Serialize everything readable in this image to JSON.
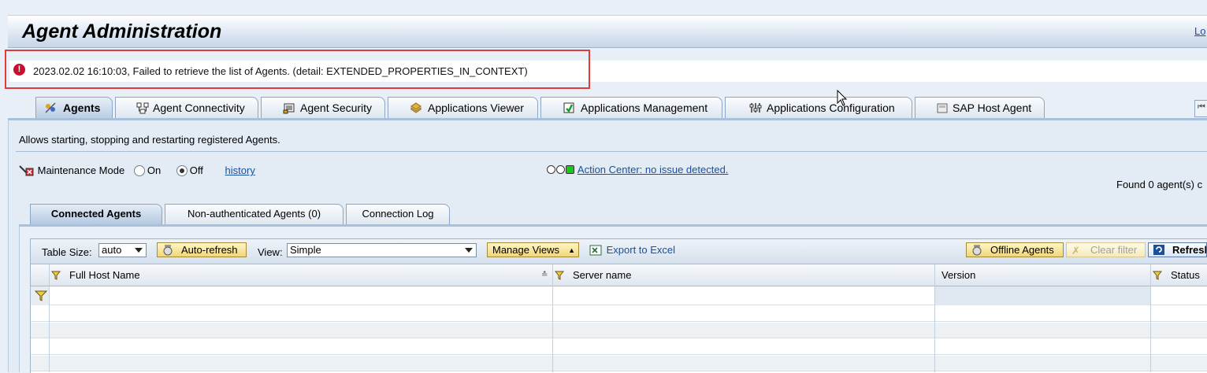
{
  "header": {
    "title": "Agent Administration",
    "logout_label": "Lo"
  },
  "message": {
    "text": "2023.02.02 16:10:03, Failed to retrieve the list of Agents. (detail: EXTENDED_PROPERTIES_IN_CONTEXT)",
    "icon": "error-icon",
    "highlight_color": "#e33b3b"
  },
  "tabs": [
    {
      "label": "Agents",
      "icon": "agents-icon",
      "active": true
    },
    {
      "label": "Agent Connectivity",
      "icon": "connectivity-icon"
    },
    {
      "label": "Agent Security",
      "icon": "security-icon"
    },
    {
      "label": "Applications Viewer",
      "icon": "viewer-icon"
    },
    {
      "label": "Applications Management",
      "icon": "management-icon"
    },
    {
      "label": "Applications Configuration",
      "icon": "configuration-icon"
    },
    {
      "label": "SAP Host Agent",
      "icon": "host-agent-icon"
    }
  ],
  "agents_page": {
    "description": "Allows starting, stopping and restarting registered Agents.",
    "maintenance_label": "Maintenance Mode",
    "on_label": "On",
    "off_label": "Off",
    "selected_mode": "Off",
    "history_link": "history",
    "action_center": "Action Center: no issue detected.",
    "found": "Found 0 agent(s) c"
  },
  "subtabs": [
    {
      "label": "Connected Agents",
      "active": true
    },
    {
      "label": "Non-authenticated Agents (0)"
    },
    {
      "label": "Connection Log"
    }
  ],
  "toolbar": {
    "table_size_label": "Table Size:",
    "table_size_value": "auto",
    "auto_refresh": "Auto-refresh",
    "view_label": "View:",
    "view_value": "Simple",
    "manage_views": "Manage Views",
    "export_excel": "Export to Excel",
    "offline_agents": "Offline Agents",
    "clear_filter": "Clear filter",
    "refresh": "Refresh"
  },
  "columns": [
    "Full Host Name",
    "Server name",
    "Version",
    "Status"
  ],
  "colors": {
    "accent": "#1a4f9c",
    "button": "#f2d676",
    "header": "#c7d6e7"
  }
}
